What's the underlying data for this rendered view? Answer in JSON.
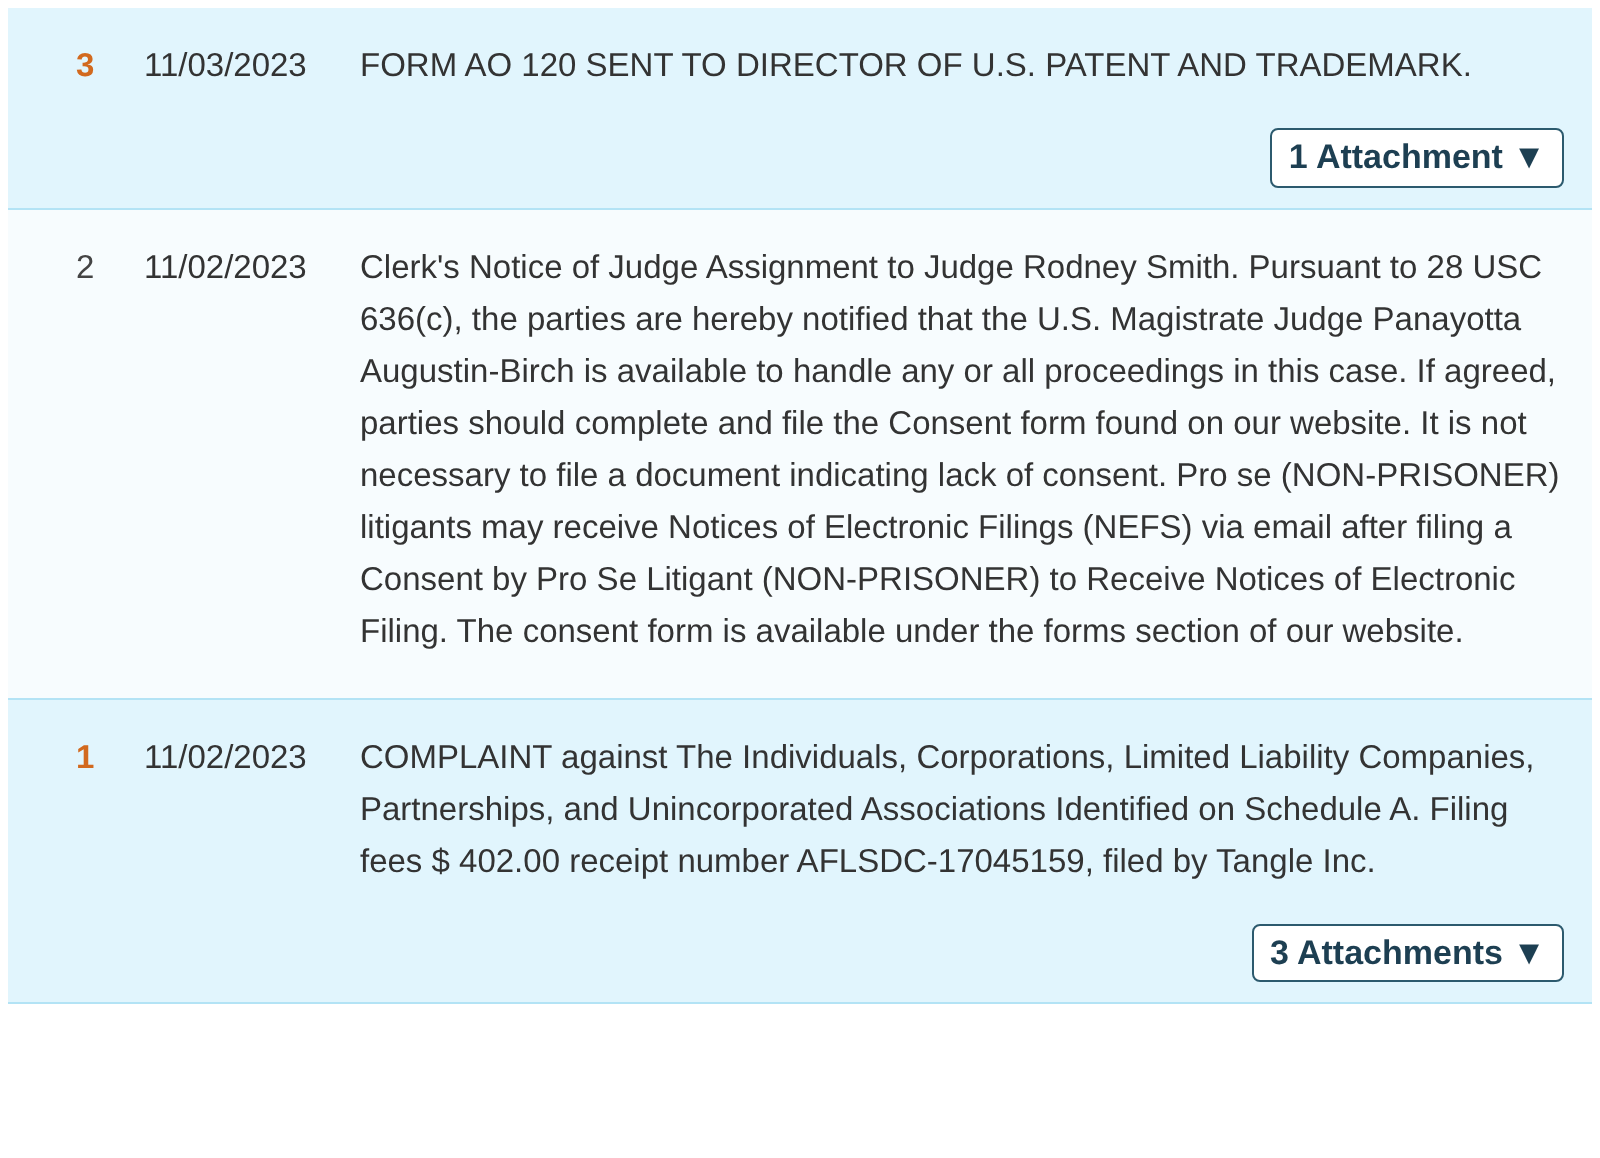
{
  "entries": [
    {
      "number": "3",
      "date": "11/03/2023",
      "text": "FORM AO 120 SENT TO DIRECTOR OF U.S. PATENT AND TRADEMARK.",
      "highlighted": true,
      "attachments": "1 Attachment ▼"
    },
    {
      "number": "2",
      "date": "11/02/2023",
      "text": "Clerk's Notice of Judge Assignment to Judge Rodney Smith. Pursuant to 28 USC 636(c), the parties are hereby notified that the U.S. Magistrate Judge Panayotta Augustin-Birch is available to handle any or all proceedings in this case. If agreed, parties should complete and file the Consent form found on our website. It is not necessary to file a document indicating lack of consent. Pro se (NON-PRISONER) litigants may receive Notices of Electronic Filings (NEFS) via email after filing a Consent by Pro Se Litigant (NON-PRISONER) to Receive Notices of Electronic Filing. The consent form is available under the forms section of our website.",
      "highlighted": false
    },
    {
      "number": "1",
      "date": "11/02/2023",
      "text": "COMPLAINT against The Individuals, Corporations, Limited Liability Companies, Partnerships, and Unincorporated Associations Identified on Schedule A. Filing fees $ 402.00 receipt number AFLSDC-17045159, filed by Tangle Inc.",
      "highlighted": true,
      "attachments": "3 Attachments ▼"
    }
  ]
}
